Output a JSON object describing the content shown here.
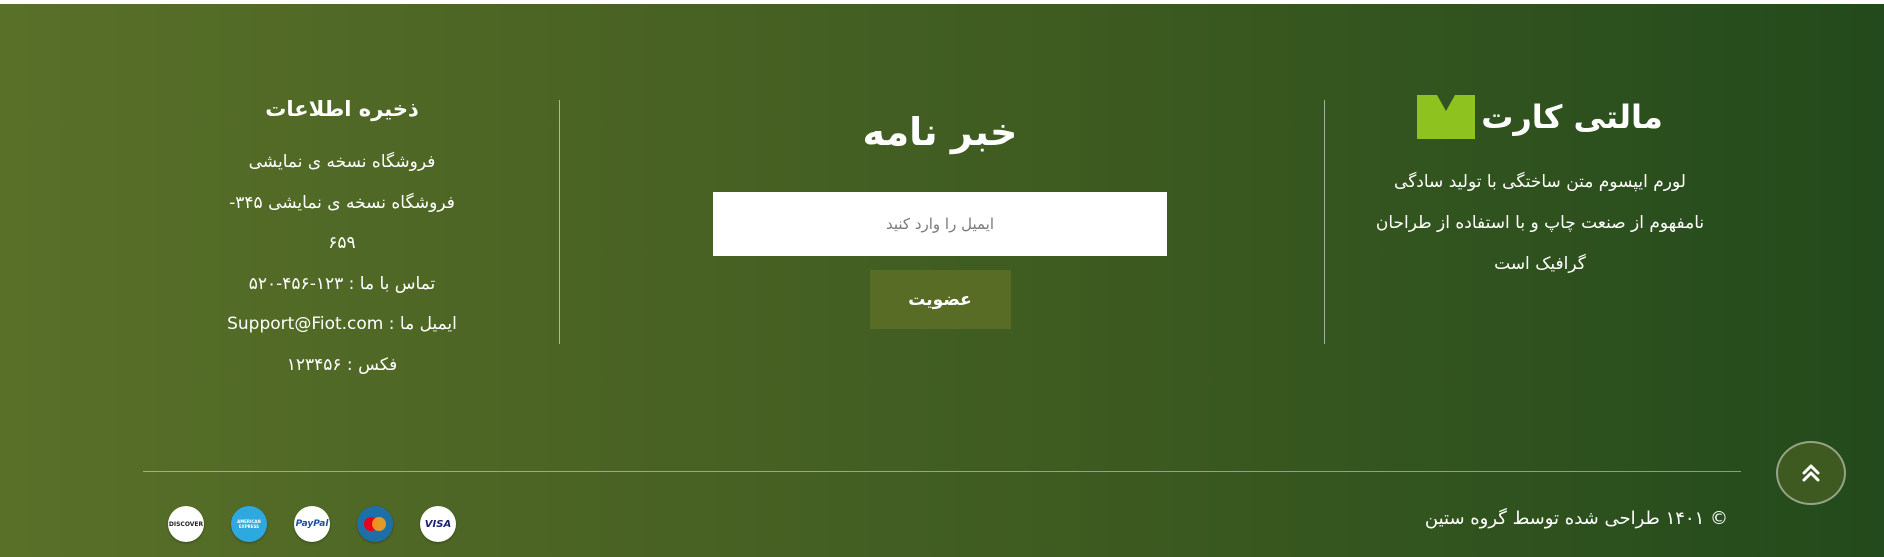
{
  "brand": {
    "name": "مالتی کارت",
    "logo_icon": "green-m-logo-icon",
    "logo_color": "#8dc21f",
    "description": [
      "لورم ایپسوم متن ساختگی با تولید سادگی",
      "نامفهوم از صنعت چاپ و با استفاده از طراحان",
      "گرافیک است"
    ]
  },
  "newsletter": {
    "title": "خبر نامه",
    "input_placeholder": "ایمیل را وارد کنید",
    "input_value": "",
    "button_label": "عضویت"
  },
  "info": {
    "title": "ذخیره اطلاعات",
    "lines": [
      "فروشگاه نسخه ی نمایشی",
      "فروشگاه نسخه ی نمایشی ۳۴۵-",
      "۶۵۹",
      "تماس با ما : ۱۲۳-۴۵۶-۵۲۰",
      "ایمیل ما : Support@Fiot.com",
      "فکس : ۱۲۳۴۵۶"
    ]
  },
  "footer_bottom": {
    "copyright": "© ۱۴۰۱ طراحی شده توسط گروه ستین",
    "scroll_top_icon": "double-chevron-up-icon",
    "payment_methods": [
      {
        "name": "VISA",
        "icon": "visa-icon",
        "bg": "#ffffff",
        "fg": "#1a1f71"
      },
      {
        "name": "MasterCard",
        "icon": "mastercard-icon",
        "bg": "#1e6fa8",
        "fg": "#ffffff"
      },
      {
        "name": "PayPal",
        "icon": "paypal-icon",
        "bg": "#ffffff",
        "fg": "#1b4f9c"
      },
      {
        "name": "AMERICAN EXPRESS",
        "icon": "amex-icon",
        "bg": "#2ea9df",
        "fg": "#ffffff"
      },
      {
        "name": "DISCOVER",
        "icon": "discover-icon",
        "bg": "#ffffff",
        "fg": "#222222"
      }
    ]
  },
  "colors": {
    "footer_gradient_start": "#587028",
    "footer_gradient_end": "#234a1c",
    "accent": "#8dc21f",
    "button_bg": "#586c26"
  }
}
